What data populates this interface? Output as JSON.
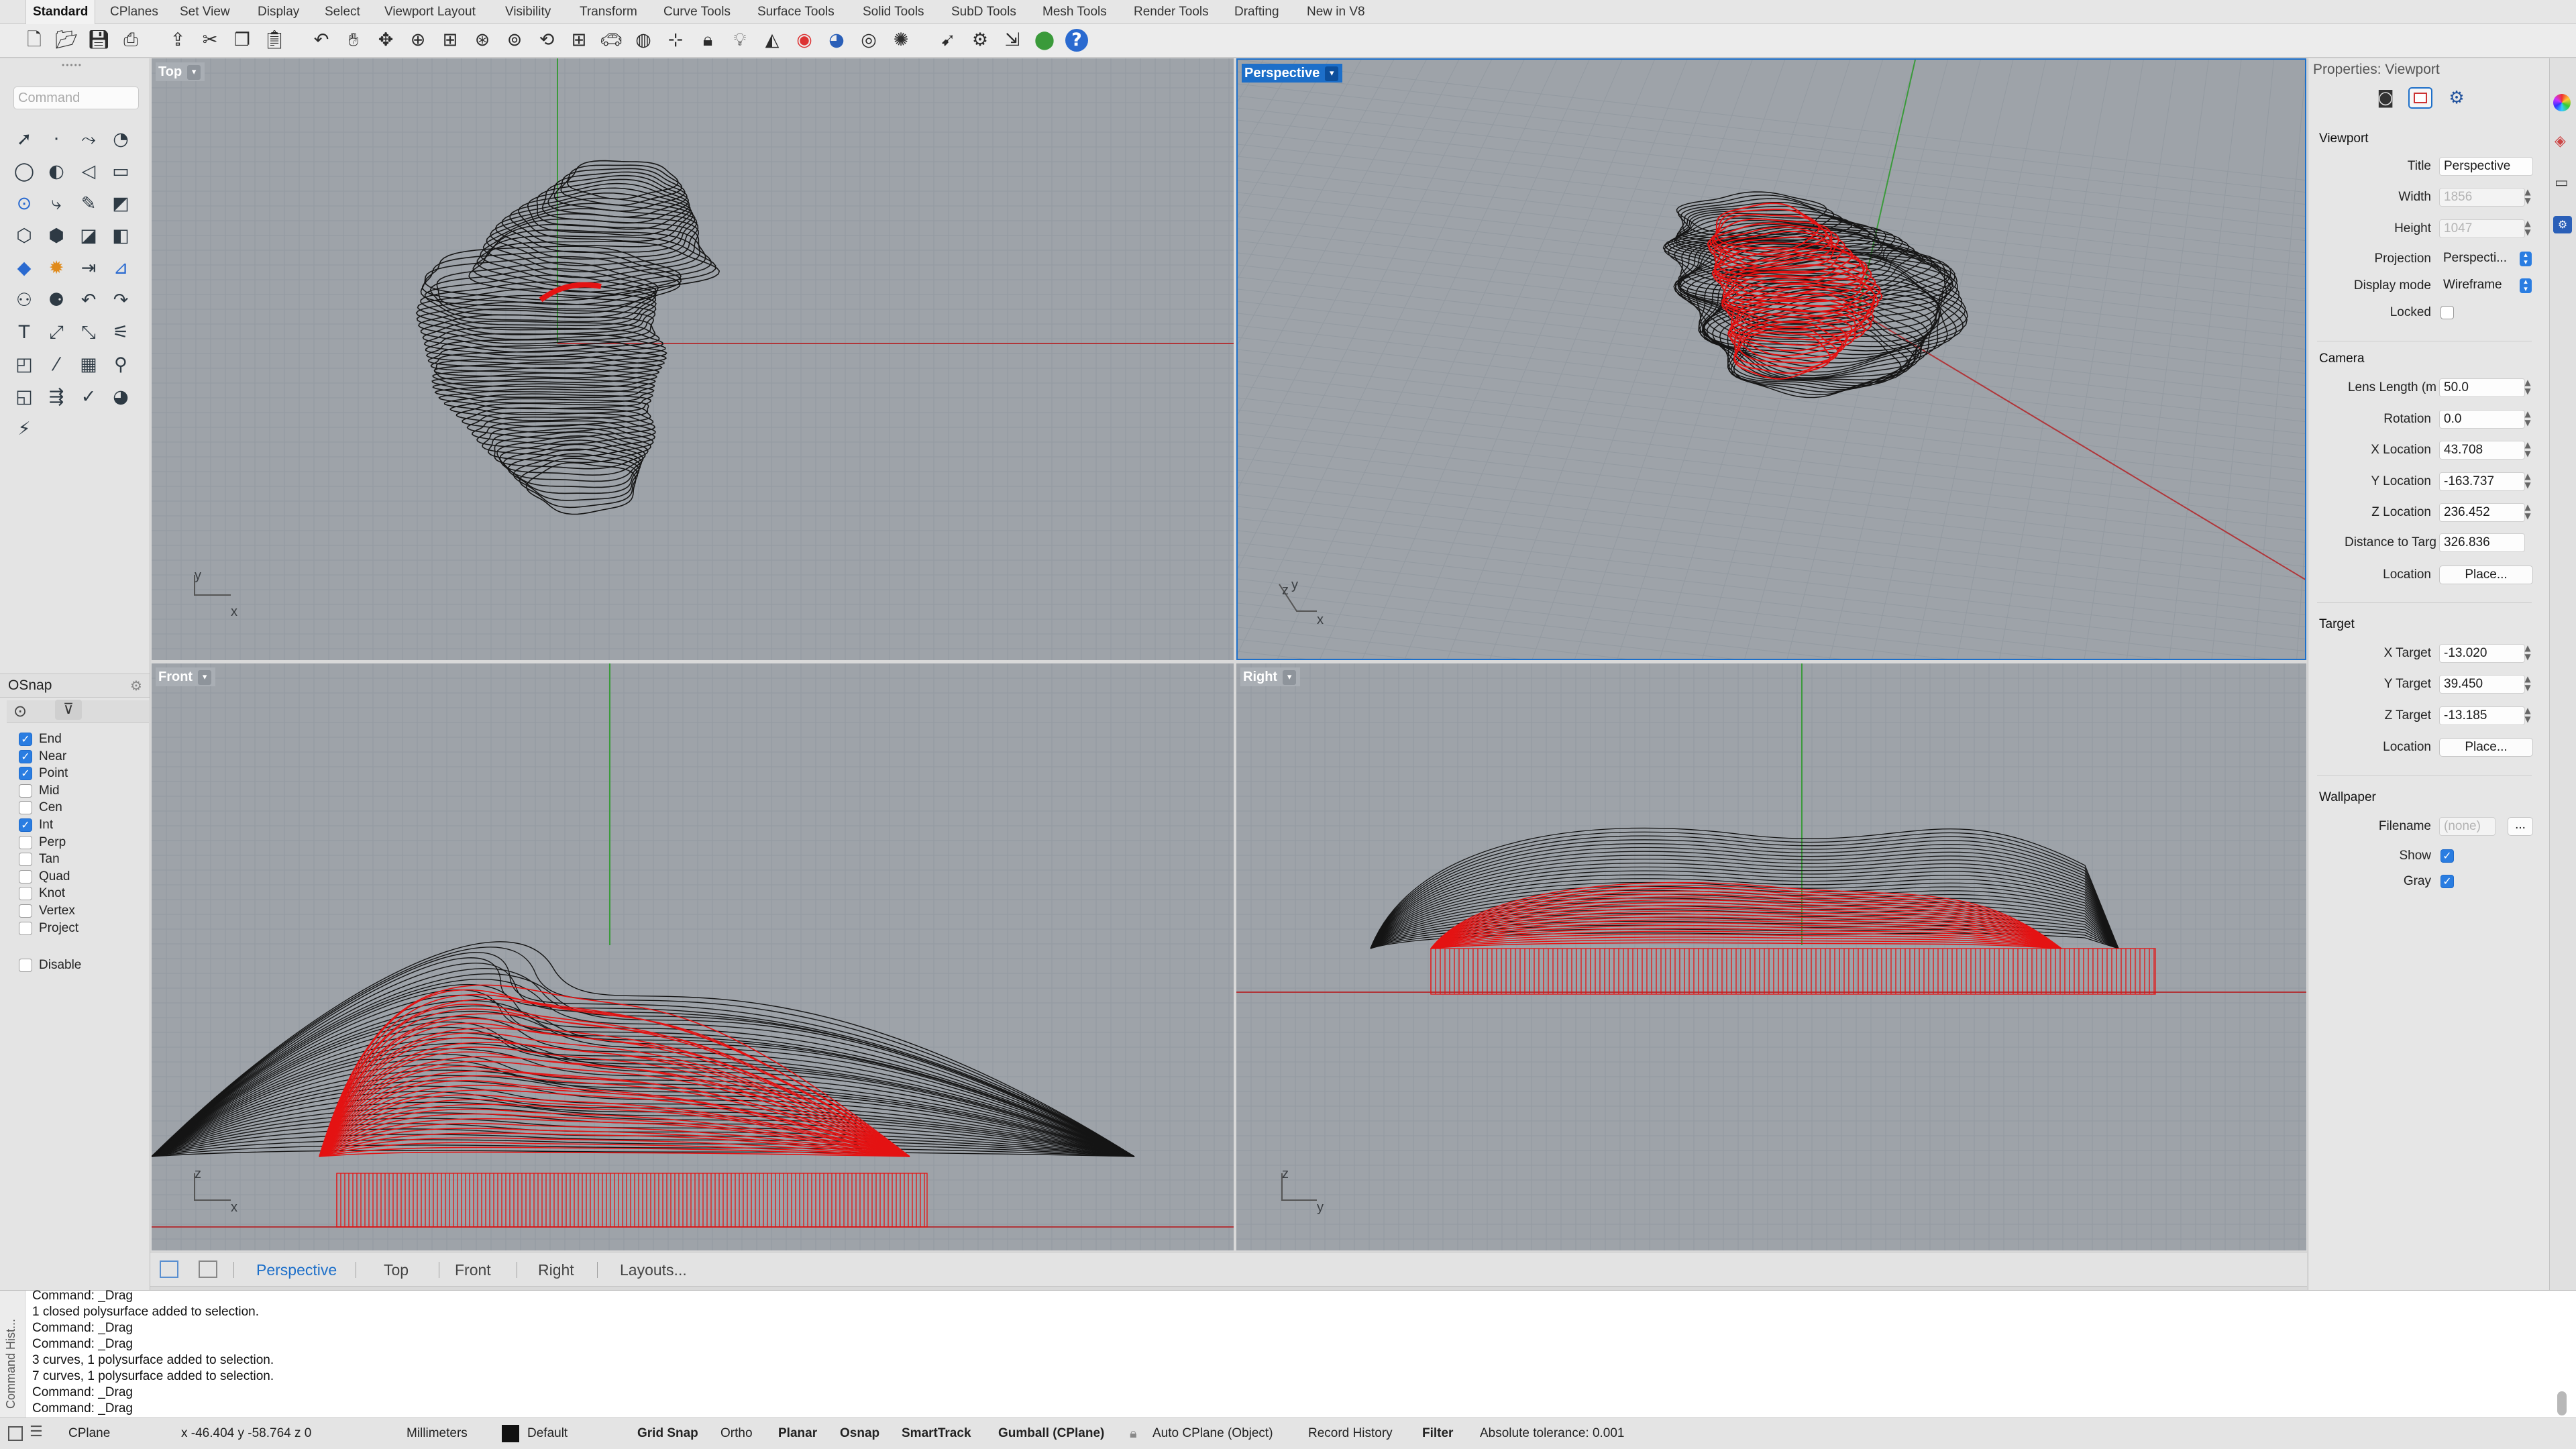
{
  "tabs": [
    "Standard",
    "CPlanes",
    "Set View",
    "Display",
    "Select",
    "Viewport Layout",
    "Visibility",
    "Transform",
    "Curve Tools",
    "Surface Tools",
    "Solid Tools",
    "SubD Tools",
    "Mesh Tools",
    "Render Tools",
    "Drafting",
    "New in V8"
  ],
  "toolbar_icons": [
    "new-document-icon",
    "open-icon",
    "save-icon",
    "print-icon",
    "import-icon",
    "cut-icon",
    "copy-icon",
    "paste-icon",
    "undo-icon",
    "pan-hand-icon",
    "move-view-icon",
    "zoom-icon",
    "zoom-window-icon",
    "zoom-extents-icon",
    "zoom-selected-icon",
    "rotate-view-icon",
    "four-view-icon",
    "car-icon",
    "shade-icon",
    "cplane-icon",
    "lock-icon",
    "lightbulb-icon",
    "material-icon",
    "color-wheel-icon",
    "render-sphere-icon",
    "environment-icon",
    "sun-icon",
    "select-icon",
    "gear-icon",
    "dimension-icon",
    "grasshopper-icon",
    "help-icon"
  ],
  "command_placeholder": "Command",
  "tool_icons": [
    "arrow",
    "·",
    "⤳",
    "◔",
    "◯",
    "◐",
    "◁",
    "▭",
    "⊙",
    "⤷",
    "✎",
    "◩",
    "⬡",
    "⬢",
    "◪",
    "◧",
    "◆",
    "✹",
    "⇥",
    "⊿",
    "⚇",
    "⚈",
    "↶",
    "↷",
    "T",
    "⤢",
    "⤡",
    "⚟",
    "◰",
    "⁄",
    "▦",
    "⚲",
    "◱",
    "⇶",
    "✓",
    "◕",
    "⚡"
  ],
  "osnap": {
    "title": "OSnap",
    "items": [
      {
        "label": "End",
        "checked": true
      },
      {
        "label": "Near",
        "checked": true
      },
      {
        "label": "Point",
        "checked": true
      },
      {
        "label": "Mid",
        "checked": false
      },
      {
        "label": "Cen",
        "checked": false
      },
      {
        "label": "Int",
        "checked": true
      },
      {
        "label": "Perp",
        "checked": false
      },
      {
        "label": "Tan",
        "checked": false
      },
      {
        "label": "Quad",
        "checked": false
      },
      {
        "label": "Knot",
        "checked": false
      },
      {
        "label": "Vertex",
        "checked": false
      },
      {
        "label": "Project",
        "checked": false
      }
    ],
    "disable": "Disable"
  },
  "viewports": {
    "top": {
      "label": "Top",
      "axis_a": "y",
      "axis_b": "x"
    },
    "perspective": {
      "label": "Perspective",
      "axis_a": "z",
      "axis_b": "y",
      "axis_c": "x"
    },
    "front": {
      "label": "Front",
      "axis_a": "z",
      "axis_b": "x"
    },
    "right": {
      "label": "Right",
      "axis_a": "z",
      "axis_b": "y"
    }
  },
  "viewport_tabs": [
    "Perspective",
    "Top",
    "Front",
    "Right",
    "Layouts..."
  ],
  "properties": {
    "title": "Properties: Viewport",
    "viewport_section": "Viewport",
    "title_label": "Title",
    "title_value": "Perspective",
    "width_label": "Width",
    "width_value": "1856",
    "height_label": "Height",
    "height_value": "1047",
    "projection_label": "Projection",
    "projection_value": "Perspecti...",
    "display_mode_label": "Display mode",
    "display_mode_value": "Wireframe",
    "locked_label": "Locked",
    "camera_section": "Camera",
    "lens_label": "Lens Length (m",
    "lens_value": "50.0",
    "rotation_label": "Rotation",
    "rotation_value": "0.0",
    "xloc_label": "X Location",
    "xloc_value": "43.708",
    "yloc_label": "Y Location",
    "yloc_value": "-163.737",
    "zloc_label": "Z Location",
    "zloc_value": "236.452",
    "dist_label": "Distance to Targ",
    "dist_value": "326.836",
    "location_label": "Location",
    "place_button": "Place...",
    "target_section": "Target",
    "xt_label": "X Target",
    "xt_value": "-13.020",
    "yt_label": "Y Target",
    "yt_value": "39.450",
    "zt_label": "Z Target",
    "zt_value": "-13.185",
    "tlocation_label": "Location",
    "tplace_button": "Place...",
    "wallpaper_section": "Wallpaper",
    "filename_label": "Filename",
    "filename_value": "(none)",
    "browse_button": "...",
    "show_label": "Show",
    "gray_label": "Gray"
  },
  "command_history_label": "Command Hist...",
  "command_history": [
    "Command: _Drag",
    "1 closed polysurface added to selection.",
    "Command: _Drag",
    "Command: _Drag",
    "3 curves, 1 polysurface added to selection.",
    "7 curves, 1 polysurface added to selection.",
    "Command: _Drag",
    "Command: _Drag"
  ],
  "status": {
    "cplane": "CPlane",
    "coords": "x -46.404   y -58.764   z 0",
    "units": "Millimeters",
    "layer": "Default",
    "grid_snap": "Grid Snap",
    "ortho": "Ortho",
    "planar": "Planar",
    "osnap": "Osnap",
    "smarttrack": "SmartTrack",
    "gumball": "Gumball (CPlane)",
    "autocplane": "Auto CPlane (Object)",
    "record_history": "Record History",
    "filter": "Filter",
    "tolerance": "Absolute tolerance: 0.001"
  },
  "colors": {
    "viewport_bg": "#9ea3a9",
    "grid": "#939aa1",
    "accent": "#1d6fc9",
    "red_axis": "#b0363a",
    "green_axis": "#3b9a3b",
    "selection": "#e41313",
    "wire": "#151515"
  }
}
